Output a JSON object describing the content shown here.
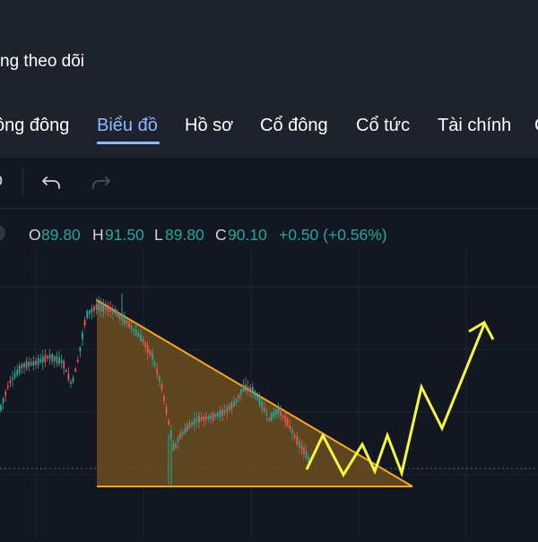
{
  "header": {
    "follow_text": "ng theo dõi"
  },
  "tabs": [
    {
      "label": "ông đông",
      "active": false
    },
    {
      "label": "Biểu đồ",
      "active": true
    },
    {
      "label": "Hồ sơ",
      "active": false
    },
    {
      "label": "Cổ đông",
      "active": false
    },
    {
      "label": "Cổ tức",
      "active": false
    },
    {
      "label": "Tài chính",
      "active": false
    },
    {
      "label": "C",
      "active": false
    }
  ],
  "toolbar": {
    "partial_glyph": "o",
    "undo_icon": "undo-icon",
    "redo_icon": "redo-icon"
  },
  "ohlc": {
    "o_label": "O",
    "o_value": "89.80",
    "h_label": "H",
    "h_value": "91.50",
    "l_label": "L",
    "l_value": "89.80",
    "c_label": "C",
    "c_value": "90.10",
    "change": "+0.50 (+0.56%)"
  },
  "colors": {
    "background": "#131722",
    "header": "#1e222d",
    "active_tab": "#8eb8ff",
    "up_candle": "#26a69a",
    "down_candle": "#ef5350",
    "triangle_outline": "#f7a627",
    "triangle_fill": "#6b4d1f",
    "projection_line": "#f5f542"
  },
  "chart_data": {
    "type": "candlestick",
    "pattern": "descending triangle",
    "current_price": 90.1,
    "projection": "zigzag breakout upward with arrow"
  }
}
